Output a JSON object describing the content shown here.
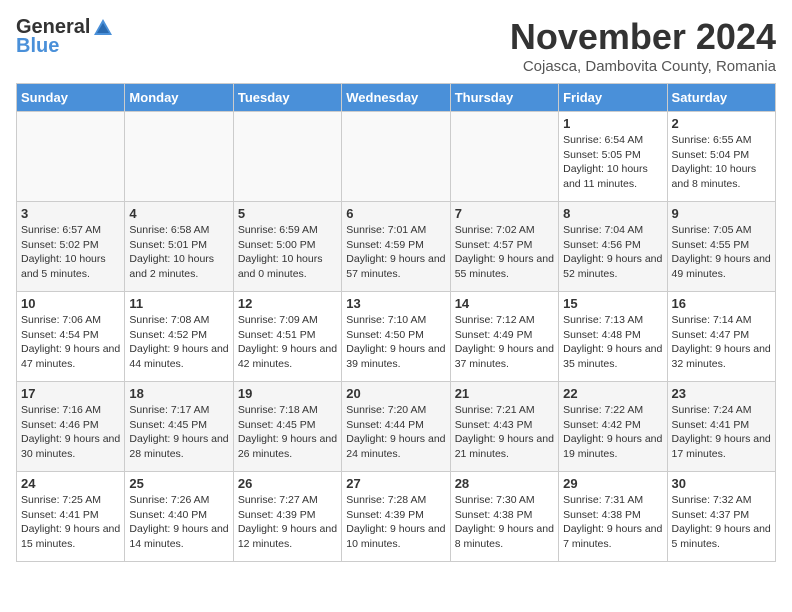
{
  "header": {
    "logo_general": "General",
    "logo_blue": "Blue",
    "month_title": "November 2024",
    "subtitle": "Cojasca, Dambovita County, Romania"
  },
  "weekdays": [
    "Sunday",
    "Monday",
    "Tuesday",
    "Wednesday",
    "Thursday",
    "Friday",
    "Saturday"
  ],
  "weeks": [
    [
      {
        "day": "",
        "info": ""
      },
      {
        "day": "",
        "info": ""
      },
      {
        "day": "",
        "info": ""
      },
      {
        "day": "",
        "info": ""
      },
      {
        "day": "",
        "info": ""
      },
      {
        "day": "1",
        "info": "Sunrise: 6:54 AM\nSunset: 5:05 PM\nDaylight: 10 hours and 11 minutes."
      },
      {
        "day": "2",
        "info": "Sunrise: 6:55 AM\nSunset: 5:04 PM\nDaylight: 10 hours and 8 minutes."
      }
    ],
    [
      {
        "day": "3",
        "info": "Sunrise: 6:57 AM\nSunset: 5:02 PM\nDaylight: 10 hours and 5 minutes."
      },
      {
        "day": "4",
        "info": "Sunrise: 6:58 AM\nSunset: 5:01 PM\nDaylight: 10 hours and 2 minutes."
      },
      {
        "day": "5",
        "info": "Sunrise: 6:59 AM\nSunset: 5:00 PM\nDaylight: 10 hours and 0 minutes."
      },
      {
        "day": "6",
        "info": "Sunrise: 7:01 AM\nSunset: 4:59 PM\nDaylight: 9 hours and 57 minutes."
      },
      {
        "day": "7",
        "info": "Sunrise: 7:02 AM\nSunset: 4:57 PM\nDaylight: 9 hours and 55 minutes."
      },
      {
        "day": "8",
        "info": "Sunrise: 7:04 AM\nSunset: 4:56 PM\nDaylight: 9 hours and 52 minutes."
      },
      {
        "day": "9",
        "info": "Sunrise: 7:05 AM\nSunset: 4:55 PM\nDaylight: 9 hours and 49 minutes."
      }
    ],
    [
      {
        "day": "10",
        "info": "Sunrise: 7:06 AM\nSunset: 4:54 PM\nDaylight: 9 hours and 47 minutes."
      },
      {
        "day": "11",
        "info": "Sunrise: 7:08 AM\nSunset: 4:52 PM\nDaylight: 9 hours and 44 minutes."
      },
      {
        "day": "12",
        "info": "Sunrise: 7:09 AM\nSunset: 4:51 PM\nDaylight: 9 hours and 42 minutes."
      },
      {
        "day": "13",
        "info": "Sunrise: 7:10 AM\nSunset: 4:50 PM\nDaylight: 9 hours and 39 minutes."
      },
      {
        "day": "14",
        "info": "Sunrise: 7:12 AM\nSunset: 4:49 PM\nDaylight: 9 hours and 37 minutes."
      },
      {
        "day": "15",
        "info": "Sunrise: 7:13 AM\nSunset: 4:48 PM\nDaylight: 9 hours and 35 minutes."
      },
      {
        "day": "16",
        "info": "Sunrise: 7:14 AM\nSunset: 4:47 PM\nDaylight: 9 hours and 32 minutes."
      }
    ],
    [
      {
        "day": "17",
        "info": "Sunrise: 7:16 AM\nSunset: 4:46 PM\nDaylight: 9 hours and 30 minutes."
      },
      {
        "day": "18",
        "info": "Sunrise: 7:17 AM\nSunset: 4:45 PM\nDaylight: 9 hours and 28 minutes."
      },
      {
        "day": "19",
        "info": "Sunrise: 7:18 AM\nSunset: 4:45 PM\nDaylight: 9 hours and 26 minutes."
      },
      {
        "day": "20",
        "info": "Sunrise: 7:20 AM\nSunset: 4:44 PM\nDaylight: 9 hours and 24 minutes."
      },
      {
        "day": "21",
        "info": "Sunrise: 7:21 AM\nSunset: 4:43 PM\nDaylight: 9 hours and 21 minutes."
      },
      {
        "day": "22",
        "info": "Sunrise: 7:22 AM\nSunset: 4:42 PM\nDaylight: 9 hours and 19 minutes."
      },
      {
        "day": "23",
        "info": "Sunrise: 7:24 AM\nSunset: 4:41 PM\nDaylight: 9 hours and 17 minutes."
      }
    ],
    [
      {
        "day": "24",
        "info": "Sunrise: 7:25 AM\nSunset: 4:41 PM\nDaylight: 9 hours and 15 minutes."
      },
      {
        "day": "25",
        "info": "Sunrise: 7:26 AM\nSunset: 4:40 PM\nDaylight: 9 hours and 14 minutes."
      },
      {
        "day": "26",
        "info": "Sunrise: 7:27 AM\nSunset: 4:39 PM\nDaylight: 9 hours and 12 minutes."
      },
      {
        "day": "27",
        "info": "Sunrise: 7:28 AM\nSunset: 4:39 PM\nDaylight: 9 hours and 10 minutes."
      },
      {
        "day": "28",
        "info": "Sunrise: 7:30 AM\nSunset: 4:38 PM\nDaylight: 9 hours and 8 minutes."
      },
      {
        "day": "29",
        "info": "Sunrise: 7:31 AM\nSunset: 4:38 PM\nDaylight: 9 hours and 7 minutes."
      },
      {
        "day": "30",
        "info": "Sunrise: 7:32 AM\nSunset: 4:37 PM\nDaylight: 9 hours and 5 minutes."
      }
    ]
  ]
}
